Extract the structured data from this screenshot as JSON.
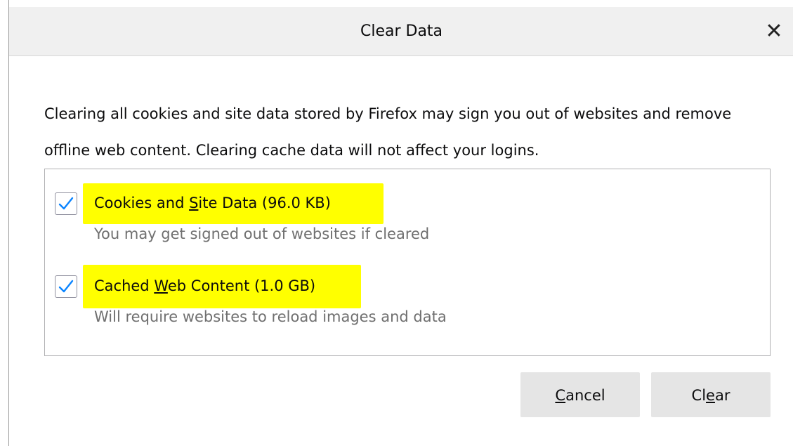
{
  "dialog": {
    "title": "Clear Data",
    "close_glyph": "✕"
  },
  "description": "Clearing all cookies and site data stored by Firefox may sign you out of websites and remove offline web content. Clearing cache data will not affect your logins.",
  "options": [
    {
      "label_pre": "Cookies and ",
      "label_key": "S",
      "label_post": "ite Data (96.0 KB)",
      "description": "You may get signed out of websites if cleared",
      "checked": true,
      "icon": "checkmark-icon"
    },
    {
      "label_pre": "Cached ",
      "label_key": "W",
      "label_post": "eb Content (1.0 GB)",
      "description": "Will require websites to reload images and data",
      "checked": true,
      "icon": "checkmark-icon"
    }
  ],
  "buttons": {
    "cancel": {
      "pre": "",
      "key": "C",
      "post": "ancel"
    },
    "clear": {
      "pre": "Cl",
      "key": "e",
      "post": "ar"
    }
  },
  "colors": {
    "checkmark": "#0a84ff",
    "highlight": "#ffff00",
    "titlebar": "#f0f0f0",
    "button": "#e5e5e5"
  }
}
